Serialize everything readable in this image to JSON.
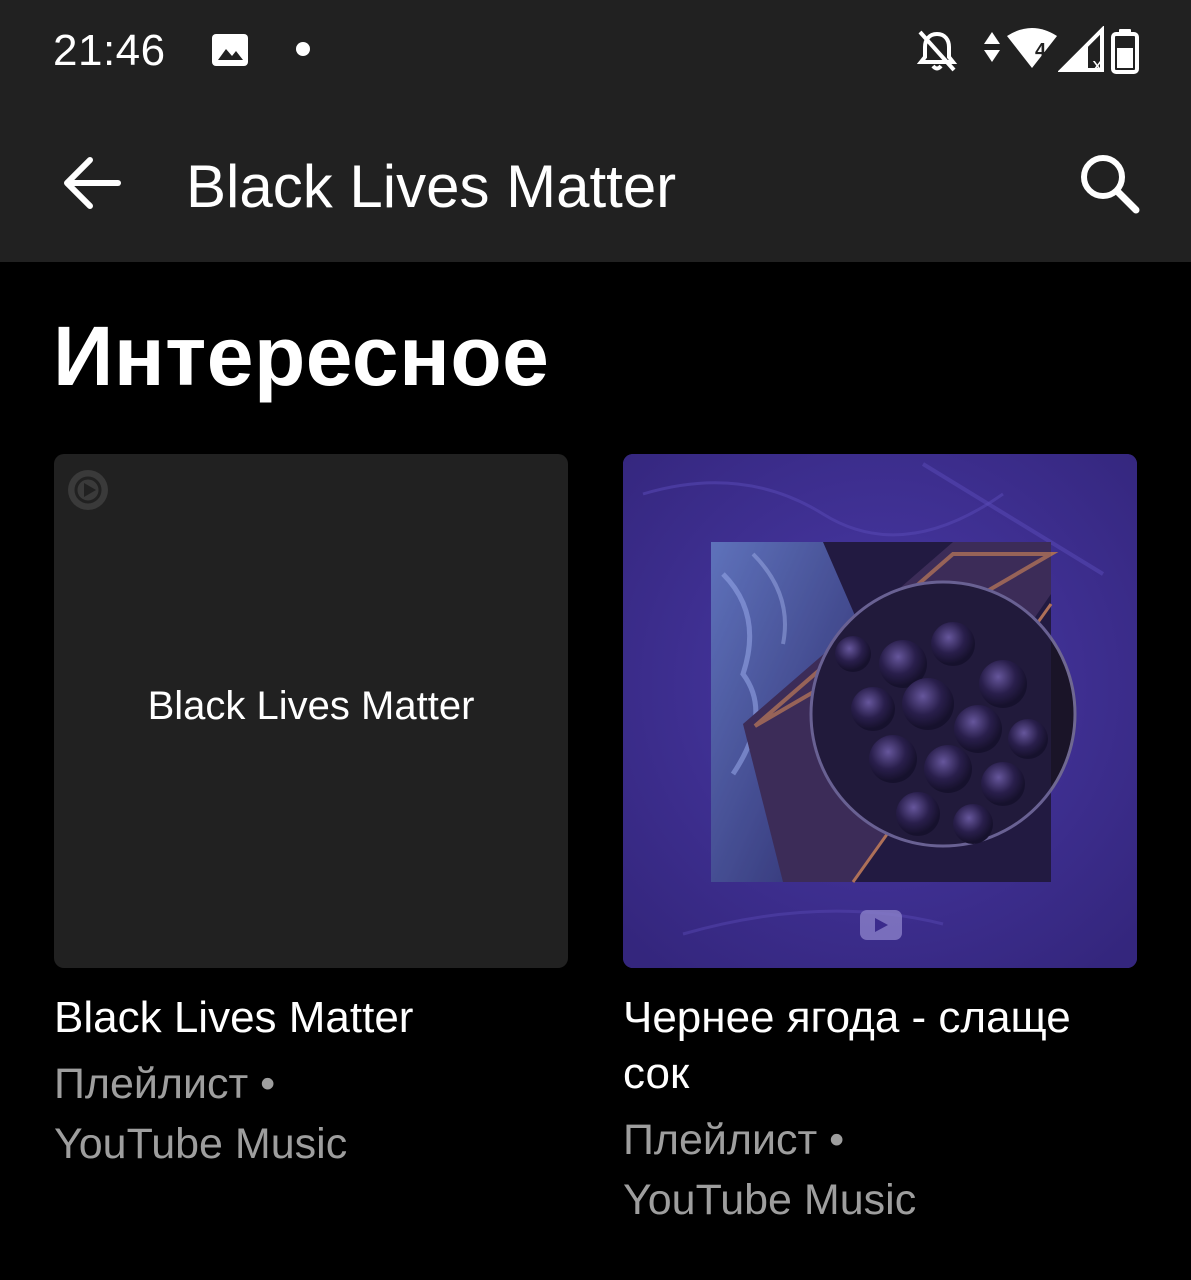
{
  "status_bar": {
    "time": "21:46",
    "icons": [
      "gallery-icon",
      "notification-dot",
      "do-not-disturb-icon",
      "data-arrows-icon",
      "wifi-icon",
      "signal-icon",
      "battery-icon"
    ],
    "wifi_badge": "4"
  },
  "app_bar": {
    "title": "Black Lives Matter",
    "back_icon": "arrow-left-icon",
    "search_icon": "search-icon"
  },
  "section": {
    "title": "Интересное"
  },
  "cards": [
    {
      "thumb_text": "Black Lives Matter",
      "title": "Black Lives Matter",
      "sub_type": "Плейлист •",
      "sub_source": "YouTube Music"
    },
    {
      "title": "Чернее ягода - слаще сок",
      "sub_type": "Плейлист •",
      "sub_source": "YouTube Music"
    }
  ],
  "colors": {
    "bar_bg": "#212121",
    "page_bg": "#000000",
    "card_bg": "#212121",
    "purple": "#3b2b8c",
    "secondary_text": "#9e9e9e"
  }
}
